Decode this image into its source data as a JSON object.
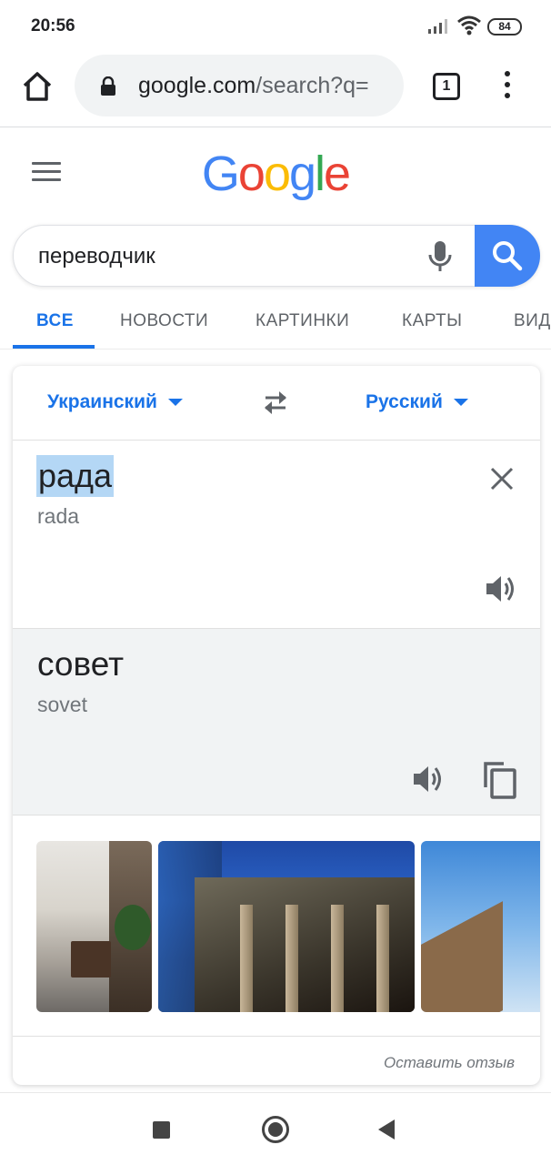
{
  "status_bar": {
    "time": "20:56",
    "battery": "84",
    "icons": [
      "signal-icon",
      "wifi-icon",
      "battery-icon"
    ]
  },
  "browser": {
    "url_host": "google.com",
    "url_path": "/search?q=",
    "tab_count": "1",
    "icons": [
      "home-icon",
      "lock-icon",
      "tabs-icon",
      "menu-icon"
    ]
  },
  "google": {
    "logo_letters": [
      "G",
      "o",
      "o",
      "g",
      "l",
      "e"
    ],
    "logo_colors": [
      "#4285f4",
      "#ea4335",
      "#fbbc05",
      "#4285f4",
      "#34a853",
      "#ea4335"
    ]
  },
  "search": {
    "query": "переводчик",
    "button_color": "#4285f4"
  },
  "tabs": [
    {
      "label": "ВСЕ",
      "active": true
    },
    {
      "label": "НОВОСТИ",
      "active": false
    },
    {
      "label": "КАРТИНКИ",
      "active": false
    },
    {
      "label": "КАРТЫ",
      "active": false
    },
    {
      "label": "ВИДЕО",
      "active": false
    }
  ],
  "translator": {
    "source_language": "Украинский",
    "target_language": "Русский",
    "source_text": "рада",
    "source_transliteration": "rada",
    "target_text": "совет",
    "target_transliteration": "sovet",
    "feedback_link": "Оставить отзыв",
    "accent_color": "#1a73e8"
  }
}
